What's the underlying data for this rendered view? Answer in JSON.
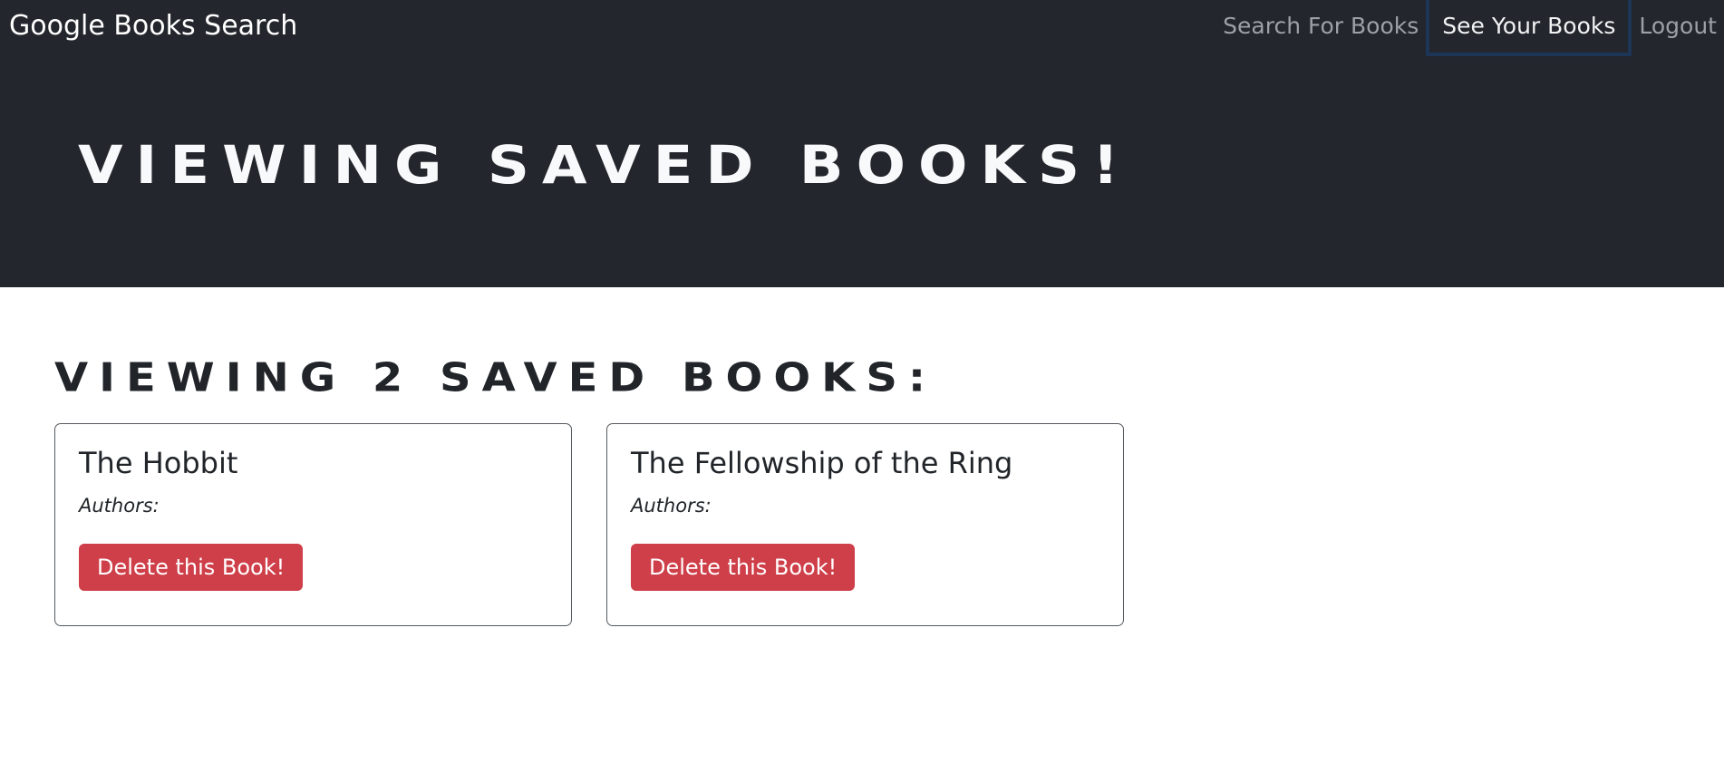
{
  "navbar": {
    "brand": "Google Books Search",
    "links": [
      {
        "label": "Search For Books"
      },
      {
        "label": "See Your Books",
        "active": true
      },
      {
        "label": "Logout"
      }
    ]
  },
  "hero": {
    "title": "VIEWING SAVED BOOKS!"
  },
  "main": {
    "count_heading": "VIEWING 2 SAVED BOOKS:",
    "books": [
      {
        "title": "The Hobbit",
        "authors_label": "Authors:",
        "delete_label": "Delete this Book!"
      },
      {
        "title": "The Fellowship of the Ring",
        "authors_label": "Authors:",
        "delete_label": "Delete this Book!"
      }
    ]
  },
  "colors": {
    "navbar_bg": "#23262c",
    "active_border": "#1d3557",
    "delete_button": "#cf3f49"
  }
}
